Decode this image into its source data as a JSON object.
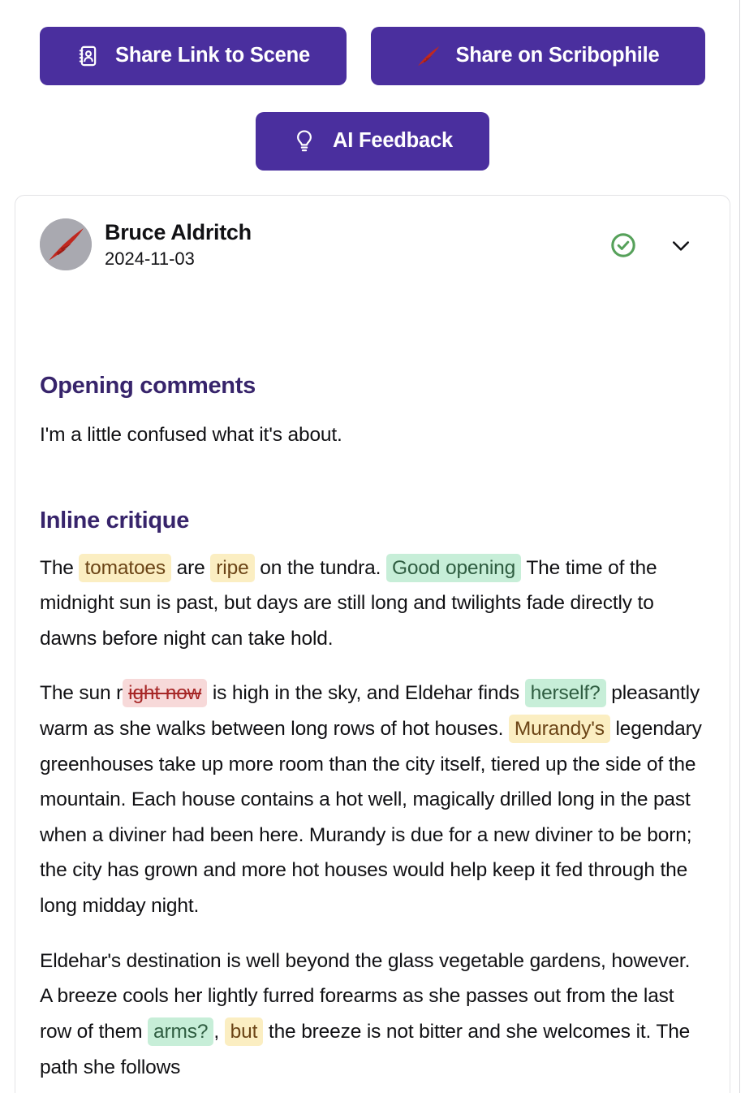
{
  "theme": {
    "brand_purple": "#4a2f9e",
    "heading_purple": "#37246b",
    "highlight_yellow_bg": "#fbeec2",
    "highlight_yellow_fg": "#6b4416",
    "highlight_green_bg": "#c7eed8",
    "highlight_green_fg": "#2f5d41",
    "highlight_red_bg": "#f7d9d9",
    "highlight_red_fg": "#a62626",
    "approved_green": "#56a15a",
    "avatar_bg": "#a9a9b0",
    "quill_red": "#c0281f"
  },
  "toolbar": {
    "share_link_label": "Share Link to Scene",
    "share_link_icon": "address-book-icon",
    "share_scribophile_label": "Share on Scribophile",
    "share_scribophile_icon": "quill-icon",
    "ai_feedback_label": "AI Feedback",
    "ai_feedback_icon": "lightbulb-icon"
  },
  "critique": {
    "author": "Bruce Aldritch",
    "date": "2024-11-03",
    "avatar_icon": "quill-avatar-icon",
    "approved_icon": "check-circle-icon",
    "collapse_icon": "chevron-down-icon",
    "sections": {
      "opening": {
        "heading": "Opening comments",
        "body": "I'm a little confused what it's about."
      },
      "inline": {
        "heading": "Inline critique"
      }
    },
    "paragraphs": [
      {
        "id": "p1",
        "runs": [
          {
            "type": "text",
            "text": "The "
          },
          {
            "type": "yellow",
            "text": "tomatoes"
          },
          {
            "type": "text",
            "text": " are "
          },
          {
            "type": "yellow",
            "text": "ripe"
          },
          {
            "type": "text",
            "text": " on the tundra. "
          },
          {
            "type": "green",
            "text": "Good opening"
          },
          {
            "type": "text",
            "text": " The time of the midnight sun is past, but days are still long and twilights fade directly to dawns before night can take hold."
          }
        ]
      },
      {
        "id": "p2",
        "runs": [
          {
            "type": "text",
            "text": "The sun r"
          },
          {
            "type": "red",
            "text": "ight now"
          },
          {
            "type": "text",
            "text": " is high in the sky, and Eldehar finds "
          },
          {
            "type": "green",
            "text": "herself?"
          },
          {
            "type": "text",
            "text": " pleasantly warm as she walks between long rows of hot houses. "
          },
          {
            "type": "yellow",
            "text": "Murandy's"
          },
          {
            "type": "text",
            "text": " legendary greenhouses take up more room than the city itself, tiered up the side of the mountain. Each house contains a hot well, magically drilled long in the past when a diviner had been here. Murandy is due for a new diviner to be born; the city has grown and more hot houses would help keep it fed through the long midday night."
          }
        ]
      },
      {
        "id": "p3",
        "runs": [
          {
            "type": "text",
            "text": "Eldehar's destination is well beyond the glass vegetable gardens, however. A breeze cools her lightly furred forearms as she passes out from the last row of them "
          },
          {
            "type": "green",
            "text": "arms?"
          },
          {
            "type": "text",
            "text": ", "
          },
          {
            "type": "yellow",
            "text": "but"
          },
          {
            "type": "text",
            "text": " the breeze is not bitter and she welcomes it. The path she follows"
          }
        ]
      }
    ]
  }
}
